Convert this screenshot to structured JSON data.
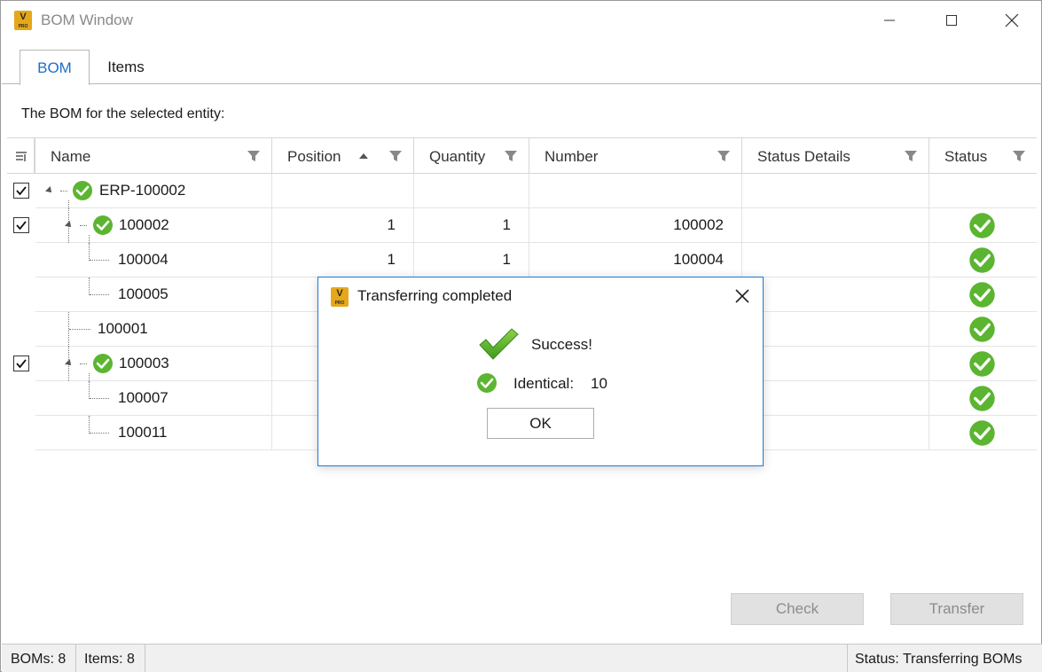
{
  "window": {
    "title": "BOM Window",
    "app_icon_letter": "V",
    "app_icon_sub": "PRO"
  },
  "tabs": [
    {
      "label": "BOM",
      "active": true
    },
    {
      "label": "Items",
      "active": false
    }
  ],
  "caption": "The BOM for the selected entity:",
  "grid": {
    "columns": [
      "Name",
      "Position",
      "Quantity",
      "Number",
      "Status Details",
      "Status"
    ],
    "sorted_column": "Position",
    "rows": [
      {
        "name": "ERP-100002",
        "position": "",
        "quantity": "",
        "number": "",
        "status_details": "",
        "checked": true,
        "level": 0,
        "expandable": true,
        "name_icon": "success-icon",
        "status_icon": ""
      },
      {
        "name": "100002",
        "position": "1",
        "quantity": "1",
        "number": "100002",
        "status_details": "",
        "checked": true,
        "level": 1,
        "expandable": true,
        "name_icon": "success-icon",
        "status_icon": "success-icon"
      },
      {
        "name": "100004",
        "position": "1",
        "quantity": "1",
        "number": "100004",
        "status_details": "",
        "checked": false,
        "level": 2,
        "expandable": false,
        "status_icon": "success-icon"
      },
      {
        "name": "100005",
        "position": "",
        "quantity": "",
        "number": "",
        "status_details": "",
        "checked": false,
        "level": 2,
        "expandable": false,
        "status_icon": "success-icon"
      },
      {
        "name": "100001",
        "position": "",
        "quantity": "",
        "number": "",
        "status_details": "",
        "checked": false,
        "level": 1,
        "expandable": false,
        "status_icon": "success-icon"
      },
      {
        "name": "100003",
        "position": "",
        "quantity": "",
        "number": "",
        "status_details": "",
        "checked": true,
        "level": 1,
        "expandable": true,
        "name_icon": "success-icon",
        "status_icon": "success-icon"
      },
      {
        "name": "100007",
        "position": "",
        "quantity": "",
        "number": "",
        "status_details": "",
        "checked": false,
        "level": 2,
        "expandable": false,
        "status_icon": "success-icon"
      },
      {
        "name": "100011",
        "position": "",
        "quantity": "",
        "number": "",
        "status_details": "",
        "checked": false,
        "level": 2,
        "expandable": false,
        "status_icon": "success-icon"
      }
    ]
  },
  "buttons": {
    "check": "Check",
    "transfer": "Transfer"
  },
  "statusbar": {
    "boms": "BOMs: 8",
    "items": "Items: 8",
    "status": "Status: Transferring BOMs"
  },
  "dialog": {
    "title": "Transferring completed",
    "success": "Success!",
    "identical_label": "Identical:",
    "identical_value": "10",
    "ok": "OK"
  },
  "colors": {
    "accent": "#1e7ad6",
    "success_green": "#5cb531",
    "brand_yellow": "#e5a81a"
  }
}
